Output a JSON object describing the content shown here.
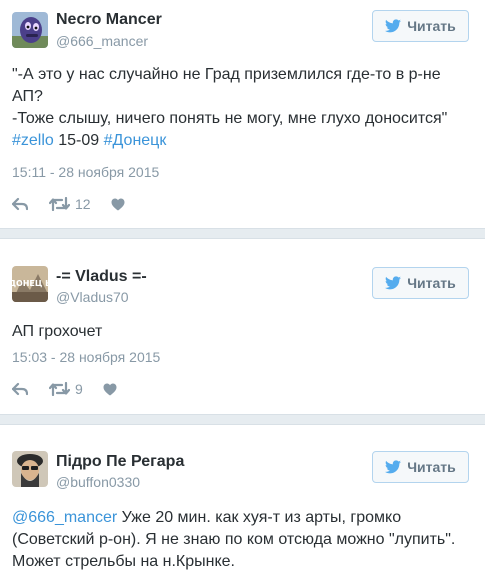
{
  "follow_label": "Читать",
  "tweets": [
    {
      "name": "Necro Mancer",
      "handle": "@666_mancer",
      "line1": "\"-А это у нас случайно не Град приземлился где-то в р-не",
      "line2": "АП?",
      "line3": "-Тоже слышу, ничего понять не могу, мне глухо доносится\"",
      "tag1": "#zello",
      "mid": " 15-09 ",
      "tag2": "#Донецк",
      "time": "15:11 - 28 ноября 2015",
      "retweets": "12"
    },
    {
      "name": "-= Vladus =-",
      "handle": "@Vladus70",
      "line1": "АП грохочет",
      "time": "15:03 - 28 ноября 2015",
      "retweets": "9",
      "avatar_text": "ДОНЕЦ Ь"
    },
    {
      "name": "Підро Пе Регара",
      "handle": "@buffon0330",
      "mention": "@666_mancer",
      "line1_rest": " Уже 20 мин. как хуя-т из арты, громко",
      "line2": "(Советский р-он). Я не знаю по ком отсюда можно \"лупить\".",
      "line3": "Может стрельбы на н.Крынке."
    }
  ],
  "colors": {
    "link": "#3b94d9",
    "meta": "#8899a6",
    "twitter_blue": "#55acee",
    "separator": "#e6ecf0"
  },
  "icons": [
    "twitter-bird-icon",
    "reply-icon",
    "retweet-icon",
    "like-heart-icon"
  ]
}
